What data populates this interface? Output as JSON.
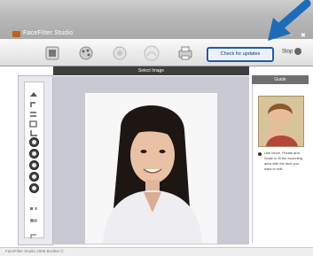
{
  "titlebar": {
    "app_title": "FaceFilter Studio",
    "minimize_label": "–",
    "close_label": "✖"
  },
  "toolbar": {
    "buttons": [
      {
        "name": "open-image-button",
        "icon": "folder-image-icon"
      },
      {
        "name": "adjust-button",
        "icon": "palette-icon"
      },
      {
        "name": "effects-button",
        "icon": "effects-icon"
      },
      {
        "name": "help-button",
        "icon": "help-icon"
      },
      {
        "name": "print-button",
        "icon": "printer-icon"
      }
    ],
    "update_label": "Check for updates",
    "stop_label": "Stop"
  },
  "mode_bar": {
    "label": "Select Image"
  },
  "guide": {
    "header": "Guide",
    "text": "Use Move, Rotate and Scale to fit the bounding area with the face you want to edit."
  },
  "statusbar": {
    "text": "FaceFilter Studio 2006  Brother  ©"
  },
  "colors": {
    "accent": "#1a5da6",
    "arrow": "#1e6bb8",
    "titlebar": "#b9b9b9",
    "canvas": "#c9c9d3",
    "mode_bar": "#3e3e3e"
  }
}
